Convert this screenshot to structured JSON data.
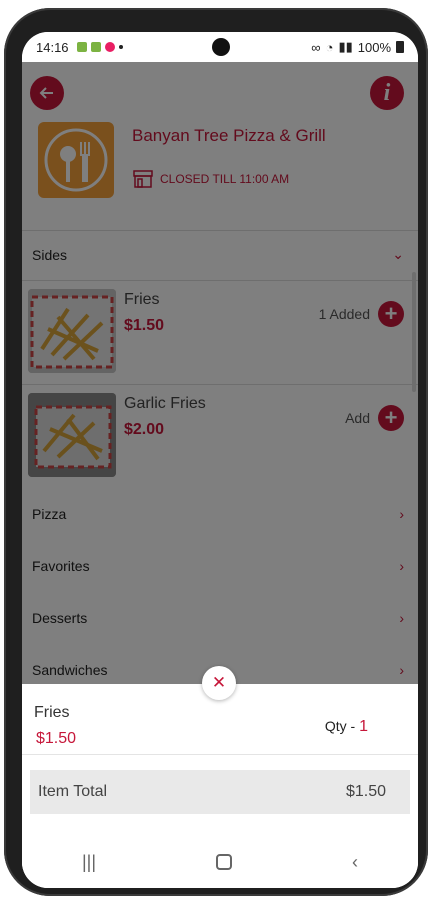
{
  "status_bar": {
    "time": "14:16",
    "battery": "100%"
  },
  "restaurant": {
    "name": "Banyan Tree Pizza & Grill",
    "status": "CLOSED TILL 11:00 AM"
  },
  "header": {
    "back_icon": "arrow-left-icon",
    "info_icon": "info-icon"
  },
  "sections": {
    "sides": "Sides",
    "pizza": "Pizza",
    "favorites": "Favorites",
    "desserts": "Desserts",
    "sandwiches": "Sandwiches"
  },
  "items": [
    {
      "name": "Fries",
      "price": "$1.50",
      "action": "1 Added"
    },
    {
      "name": "Garlic Fries",
      "price": "$2.00",
      "action": "Add"
    }
  ],
  "sheet": {
    "item_name": "Fries",
    "item_price": "$1.50",
    "qty_label": "Qty - ",
    "qty_value": "1",
    "total_label": "Item Total",
    "total_value": "$1.50"
  },
  "colors": {
    "accent": "#c6173a"
  }
}
